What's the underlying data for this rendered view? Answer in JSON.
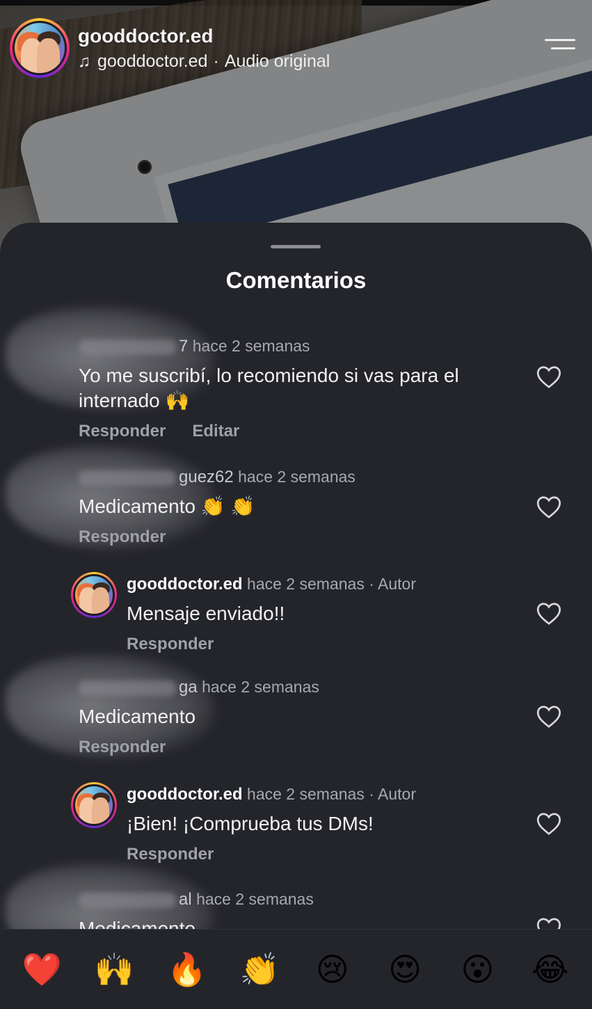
{
  "reel": {
    "username": "gooddoctor.ed",
    "audio_user": "gooddoctor.ed",
    "audio_separator": "·",
    "audio_label": "Audio original"
  },
  "sheet": {
    "title": "Comentarios"
  },
  "comments": [
    {
      "username_visible": "7",
      "time": "hace 2 semanas",
      "text": "Yo me suscribí, lo recomiendo si vas para el internado 🙌",
      "reply_label": "Responder",
      "edit_label": "Editar"
    },
    {
      "username_visible": "guez62",
      "time": "hace 2 semanas",
      "text": "Medicamento 👏 👏",
      "reply_label": "Responder"
    },
    {
      "username": "gooddoctor.ed",
      "time": "hace 2 semanas",
      "author_tag": "· Autor",
      "text": "Mensaje enviado!!",
      "reply_label": "Responder",
      "is_reply": true
    },
    {
      "username_visible": "ga",
      "time": "hace 2 semanas",
      "text": "Medicamento",
      "reply_label": "Responder"
    },
    {
      "username": "gooddoctor.ed",
      "time": "hace 2 semanas",
      "author_tag": "· Autor",
      "text": "¡Bien! ¡Comprueba tus DMs!",
      "reply_label": "Responder",
      "is_reply": true
    },
    {
      "username_visible": "al",
      "time": "hace 2 semanas",
      "text": "Medicamento",
      "is_partial": true
    }
  ],
  "emoji_bar": [
    "❤️",
    "🙌",
    "🔥",
    "👏",
    "😢",
    "😍",
    "😮",
    "😂"
  ],
  "colors": {
    "sheet_bg": "#24252a",
    "text_primary": "#f2f2f2",
    "text_secondary": "#a8a9ae"
  }
}
